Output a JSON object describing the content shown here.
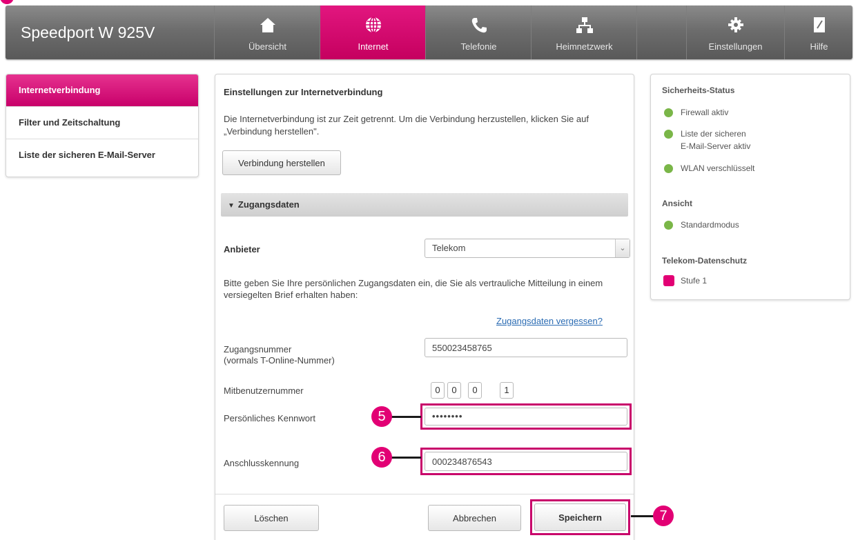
{
  "app_title": "Speedport W 925V",
  "nav": {
    "items": [
      {
        "label": "Übersicht",
        "icon": "home-icon"
      },
      {
        "label": "Internet",
        "icon": "globe-icon"
      },
      {
        "label": "Telefonie",
        "icon": "phone-icon"
      },
      {
        "label": "Heimnetzwerk",
        "icon": "network-icon"
      },
      {
        "label": "Einstellungen",
        "icon": "gear-icon"
      },
      {
        "label": "Hilfe",
        "icon": "help-book-icon"
      }
    ],
    "active": "Internet",
    "accent_color": "#e20074"
  },
  "sidebar": {
    "items": [
      {
        "label": "Internetverbindung"
      },
      {
        "label": "Filter und Zeitschaltung"
      },
      {
        "label": "Liste der sicheren E-Mail-Server"
      }
    ]
  },
  "main": {
    "title": "Einstellungen zur Internetverbindung",
    "intro": "Die Internetverbindung ist zur Zeit getrennt. Um die Verbindung herzustellen, klicken Sie auf „Verbindung herstellen\".",
    "connect_button": "Verbindung herstellen",
    "section_title": "Zugangsdaten",
    "provider_label": "Anbieter",
    "provider_value": "Telekom",
    "credentials_text": "Bitte geben Sie Ihre persönlichen Zugangsdaten ein, die Sie als vertrauliche Mitteilung in einem versiegelten Brief erhalten haben:",
    "forgot_link": "Zugangsdaten vergessen?",
    "access_number_label": "Zugangsnummer",
    "access_number_sublabel": "(vormals T-Online-Nummer)",
    "access_number_value": "550023458765",
    "co_user_label": "Mitbenutzernummer",
    "co_user_digits": [
      "0",
      "0",
      "0",
      "1"
    ],
    "password_label": "Persönliches Kennwort",
    "password_value": "••••••••",
    "connection_id_label": "Anschlusskennung",
    "connection_id_value": "000234876543",
    "delete_button": "Löschen",
    "cancel_button": "Abbrechen",
    "save_button": "Speichern"
  },
  "callouts": [
    "5",
    "6",
    "7"
  ],
  "status": {
    "security_title": "Sicherheits-Status",
    "security_items": [
      "Firewall aktiv",
      "Liste der sicheren",
      "E-Mail-Server aktiv",
      "WLAN verschlüsselt"
    ],
    "view_title": "Ansicht",
    "view_item": "Standardmodus",
    "privacy_title": "Telekom-Datenschutz",
    "privacy_item": "Stufe 1",
    "ok_color": "#7ab648"
  }
}
